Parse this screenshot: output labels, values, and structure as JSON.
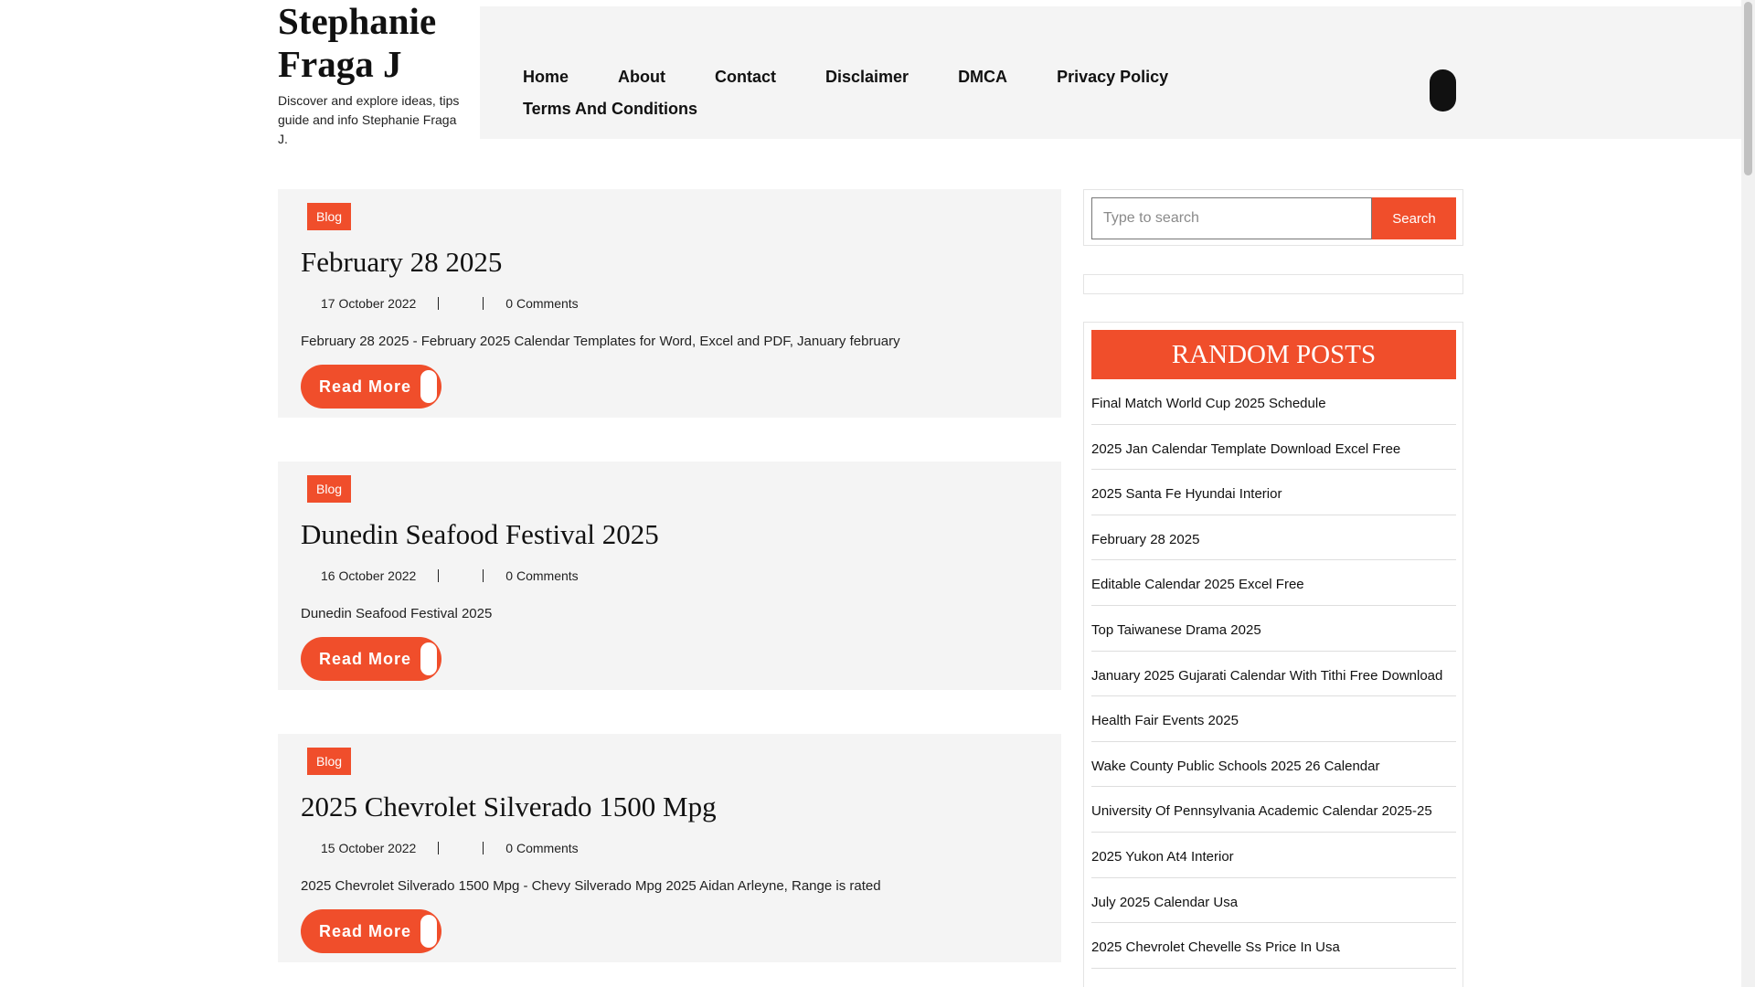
{
  "site": {
    "title_line1": "Stephanie",
    "title_line2": "Fraga J",
    "tagline": "Discover and explore ideas, tips guide and info Stephanie Fraga J."
  },
  "nav": {
    "items": [
      "Home",
      "About",
      "Contact",
      "Disclaimer",
      "DMCA",
      "Privacy Policy",
      "Terms And Conditions"
    ]
  },
  "posts": [
    {
      "category": "Blog",
      "title": "February 28 2025",
      "date": "17 October 2022",
      "comments": "0 Comments",
      "excerpt": "February 28 2025 - February 2025 Calendar Templates for Word, Excel and PDF, January february",
      "read_more": "Read More"
    },
    {
      "category": "Blog",
      "title": "Dunedin Seafood Festival 2025",
      "date": "16 October 2022",
      "comments": "0 Comments",
      "excerpt": "Dunedin Seafood Festival 2025",
      "read_more": "Read More"
    },
    {
      "category": "Blog",
      "title": "2025 Chevrolet Silverado 1500 Mpg",
      "date": "15 October 2022",
      "comments": "0 Comments",
      "excerpt": "2025 Chevrolet Silverado 1500 Mpg - Chevy Silverado Mpg 2025 Aidan Arleyne, Range is rated",
      "read_more": "Read More"
    }
  ],
  "sidebar": {
    "search": {
      "placeholder": "Type to search",
      "button": "Search"
    },
    "random_posts": {
      "heading": "RANDOM POSTS",
      "items": [
        "Final Match World Cup 2025 Schedule",
        "2025 Jan Calendar Template Download Excel Free",
        "2025 Santa Fe Hyundai Interior",
        "February 28 2025",
        "Editable Calendar 2025 Excel Free",
        "Top Taiwanese Drama 2025",
        "January 2025 Gujarati Calendar With Tithi Free Download",
        "Health Fair Events 2025",
        "Wake County Public Schools 2025 26 Calendar",
        "University Of Pennsylvania Academic Calendar 2025-25",
        "2025 Yukon At4 Interior",
        "July 2025 Calendar Usa",
        "2025 Chevrolet Chevelle Ss Price In Usa"
      ]
    }
  },
  "colors": {
    "accent": "#f04e2b",
    "panel": "#f4f4f4"
  }
}
